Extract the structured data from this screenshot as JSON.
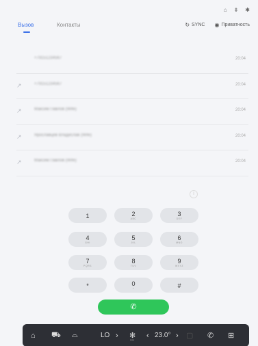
{
  "status_bar": {
    "icons": [
      "lock-icon",
      "download-icon",
      "bluetooth-icon"
    ],
    "glyphs": [
      "⌂",
      "⇟",
      "✱"
    ]
  },
  "tabs": [
    {
      "label": "Вызов",
      "active": true
    },
    {
      "label": "Контакты",
      "active": false
    }
  ],
  "actions": {
    "sync_label": "SYNC",
    "privacy_label": "Приватность",
    "sync_icon": "↻",
    "privacy_icon": "◉"
  },
  "calls": [
    {
      "name": "+79151234567",
      "time": "20:04",
      "has_icon": false
    },
    {
      "name": "+79151234567",
      "time": "20:04",
      "has_icon": true
    },
    {
      "name": "Максим Павлов (Wife)",
      "time": "20:04",
      "has_icon": true
    },
    {
      "name": "Ярославцев Владислав (Wife)",
      "time": "20:04",
      "has_icon": true
    },
    {
      "name": "Максим Павлов (Wife)",
      "time": "20:04",
      "has_icon": true
    }
  ],
  "call_icon_glyph": "↗",
  "keypad": [
    {
      "digit": "1",
      "sub": ""
    },
    {
      "digit": "2",
      "sub": "ABC"
    },
    {
      "digit": "3",
      "sub": "DEF"
    },
    {
      "digit": "4",
      "sub": "GHI"
    },
    {
      "digit": "5",
      "sub": "JKL"
    },
    {
      "digit": "6",
      "sub": "MNO"
    },
    {
      "digit": "7",
      "sub": "PQRS"
    },
    {
      "digit": "8",
      "sub": "TUV"
    },
    {
      "digit": "9",
      "sub": "WXYZ"
    },
    {
      "digit": "*",
      "sub": ""
    },
    {
      "digit": "0",
      "sub": "+"
    },
    {
      "digit": "#",
      "sub": ""
    }
  ],
  "call_button_icon": "✆",
  "dock": {
    "fan_mode": "LO",
    "temperature": "23.0°",
    "fan_label": "Auto",
    "glyphs": {
      "home": "⌂",
      "car": "⛟",
      "seat": "⌓",
      "arrow_right": "›",
      "fan": "✻",
      "arrow_left": "‹",
      "empty": "▢",
      "phone": "✆",
      "apps": "⊞"
    }
  },
  "colors": {
    "accent": "#3a6fe8",
    "call_green": "#2fc65a",
    "dock_bg": "#2d2f35"
  }
}
